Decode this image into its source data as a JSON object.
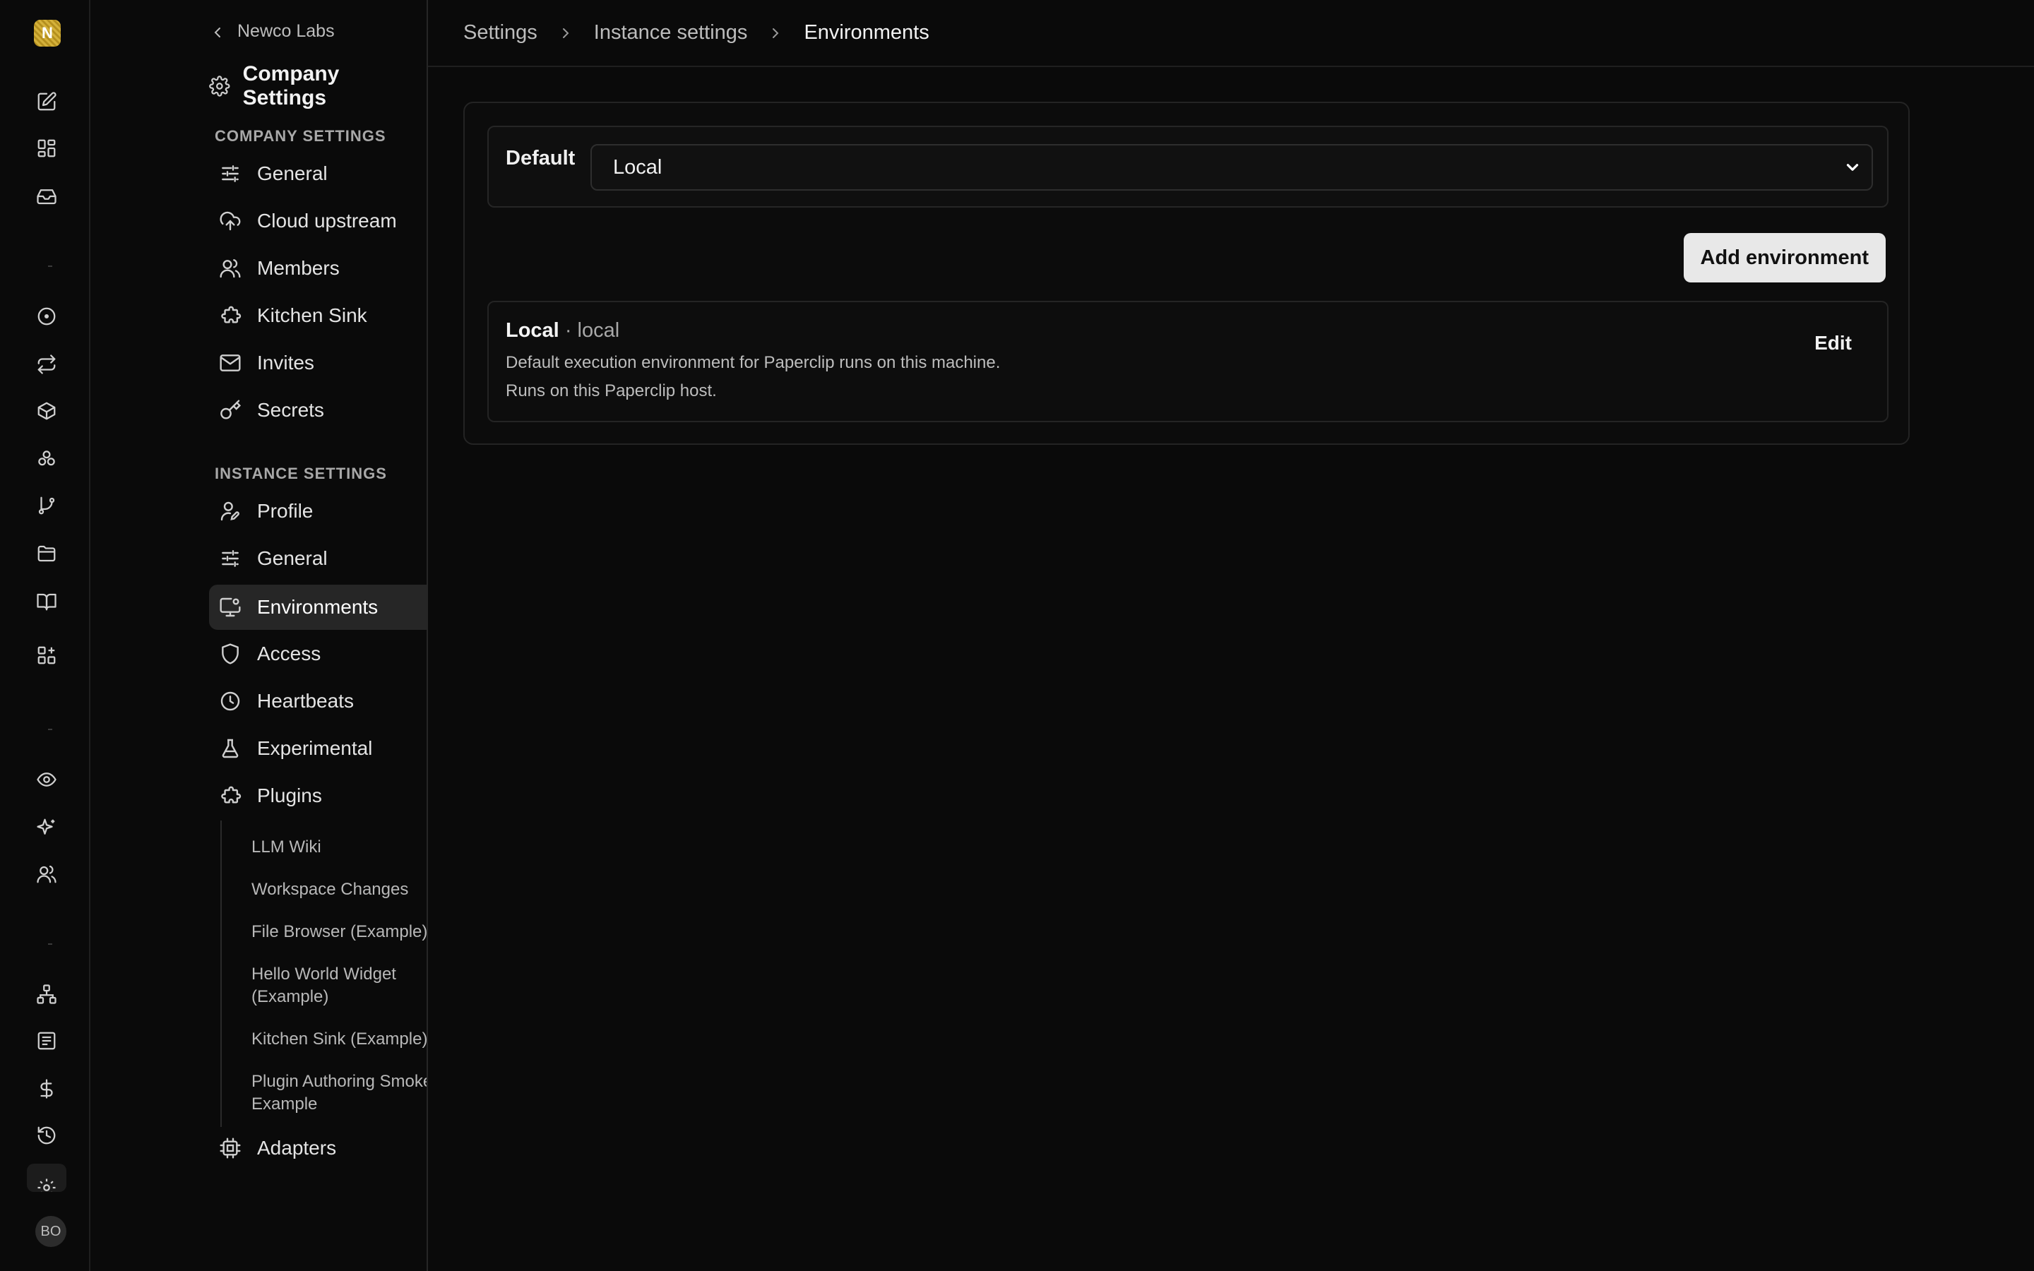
{
  "rail": {
    "logo_letter": "N",
    "avatar_initials": "BO",
    "icons": [
      "edit-icon",
      "dashboard-icon",
      "inbox-icon",
      "circle-dot-icon",
      "repeat-icon",
      "box-icon",
      "components-icon",
      "git-branch-icon",
      "folder-icon",
      "book-icon",
      "plugins-icon",
      "eye-icon",
      "sparkles-icon",
      "users-icon",
      "network-icon",
      "list-icon",
      "dollar-icon",
      "history-icon",
      "gear-icon"
    ]
  },
  "sidebar": {
    "back_label": "Newco Labs",
    "title": "Company Settings",
    "company_section_label": "COMPANY SETTINGS",
    "company_items": [
      {
        "label": "General",
        "icon": "sliders-icon"
      },
      {
        "label": "Cloud upstream",
        "icon": "cloud-upload-icon"
      },
      {
        "label": "Members",
        "icon": "users-icon"
      },
      {
        "label": "Kitchen Sink",
        "icon": "puzzle-icon"
      },
      {
        "label": "Invites",
        "icon": "mail-icon"
      },
      {
        "label": "Secrets",
        "icon": "key-icon"
      }
    ],
    "instance_section_label": "INSTANCE SETTINGS",
    "instance_items": [
      {
        "label": "Profile",
        "icon": "user-pen-icon"
      },
      {
        "label": "General",
        "icon": "sliders-icon"
      },
      {
        "label": "Environments",
        "icon": "monitor-cog-icon"
      },
      {
        "label": "Access",
        "icon": "shield-icon"
      },
      {
        "label": "Heartbeats",
        "icon": "clock-icon"
      },
      {
        "label": "Experimental",
        "icon": "flask-icon"
      },
      {
        "label": "Plugins",
        "icon": "puzzle-icon"
      }
    ],
    "plugin_items": [
      "LLM Wiki",
      "Workspace Changes",
      "File Browser (Example)",
      "Hello World Widget (Example)",
      "Kitchen Sink (Example)",
      "Plugin Authoring Smoke Example"
    ],
    "adapters_label": "Adapters"
  },
  "breadcrumb": {
    "items": [
      "Settings",
      "Instance settings",
      "Environments"
    ]
  },
  "environments": {
    "default_label": "Default",
    "default_value": "Local",
    "add_button_label": "Add environment",
    "list": [
      {
        "name": "Local",
        "slug": "· local",
        "description": "Default execution environment for Paperclip runs on this machine.",
        "subtext": "Runs on this Paperclip host.",
        "edit_label": "Edit"
      }
    ]
  },
  "colors": {
    "background": "#0a0a0a",
    "active_nav": "#262626",
    "button_bg": "#e8e8e8",
    "logo": "#c9a227"
  }
}
